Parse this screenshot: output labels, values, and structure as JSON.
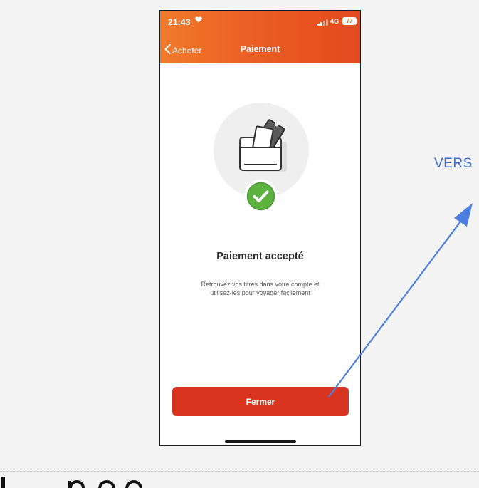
{
  "status_bar": {
    "time": "21:43",
    "network": "4G",
    "battery": "77"
  },
  "nav": {
    "back_label": "Acheter",
    "title": "Paiement"
  },
  "content": {
    "title": "Paiement accepté",
    "subtitle_line1": "Retrouvez vos titres dans votre compte et",
    "subtitle_line2": "utilisez-les pour voyager facilement"
  },
  "actions": {
    "close_label": "Fermer"
  },
  "annotation": {
    "text": "VERS"
  },
  "colors": {
    "brand_orange": "#ea5a22",
    "button_red": "#d9341f",
    "success_green": "#5db240",
    "annotation_blue": "#3d6fd6"
  },
  "icons": {
    "heart": "heart-icon",
    "back": "chevron-left-icon",
    "illustration": "ticket-wallet-icon",
    "check": "checkmark-circle-icon"
  }
}
